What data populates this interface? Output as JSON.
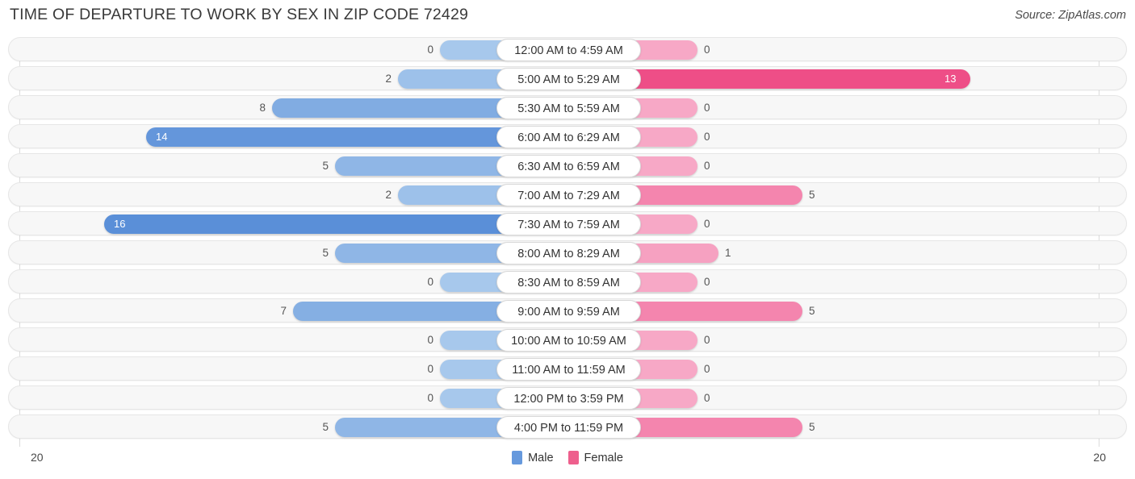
{
  "header": {
    "title": "TIME OF DEPARTURE TO WORK BY SEX IN ZIP CODE 72429",
    "source": "Source: ZipAtlas.com"
  },
  "legend": {
    "male_label": "Male",
    "female_label": "Female",
    "male_color": "#6699dd",
    "female_color": "#ee5f8d"
  },
  "axis": {
    "left_max_label": "20",
    "right_max_label": "20"
  },
  "chart_data": {
    "type": "bar",
    "orientation": "horizontal-diverging",
    "title": "TIME OF DEPARTURE TO WORK BY SEX IN ZIP CODE 72429",
    "xlabel": "",
    "ylabel": "",
    "xlim": [
      20,
      20
    ],
    "grid": false,
    "legend_position": "bottom-center",
    "categories": [
      "12:00 AM to 4:59 AM",
      "5:00 AM to 5:29 AM",
      "5:30 AM to 5:59 AM",
      "6:00 AM to 6:29 AM",
      "6:30 AM to 6:59 AM",
      "7:00 AM to 7:29 AM",
      "7:30 AM to 7:59 AM",
      "8:00 AM to 8:29 AM",
      "8:30 AM to 8:59 AM",
      "9:00 AM to 9:59 AM",
      "10:00 AM to 10:59 AM",
      "11:00 AM to 11:59 AM",
      "12:00 PM to 3:59 PM",
      "4:00 PM to 11:59 PM"
    ],
    "series": [
      {
        "name": "Male",
        "values": [
          0,
          2,
          8,
          14,
          5,
          2,
          16,
          5,
          0,
          7,
          0,
          0,
          0,
          5
        ]
      },
      {
        "name": "Female",
        "values": [
          0,
          13,
          0,
          0,
          0,
          5,
          0,
          1,
          0,
          5,
          0,
          0,
          0,
          5
        ]
      }
    ]
  }
}
